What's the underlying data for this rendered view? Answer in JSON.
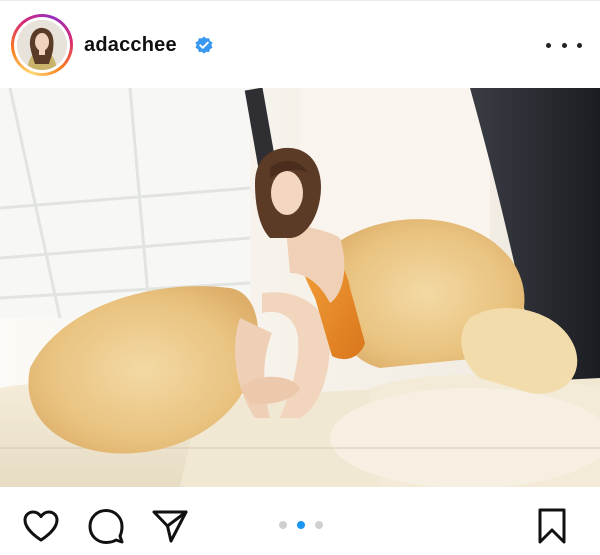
{
  "post": {
    "username": "adacchee",
    "verified": true,
    "more_icon": "more-horizontal-icon",
    "photo_description_icon": "post-photo",
    "carousel": {
      "total": 3,
      "current": 2
    },
    "actions": {
      "like_icon": "heart-icon",
      "comment_icon": "comment-icon",
      "share_icon": "send-icon",
      "save_icon": "bookmark-icon"
    },
    "colors": {
      "accent_blue": "#1a95f3",
      "verified_blue": "#3897f0",
      "inactive_dot": "#cfcfcf"
    }
  }
}
